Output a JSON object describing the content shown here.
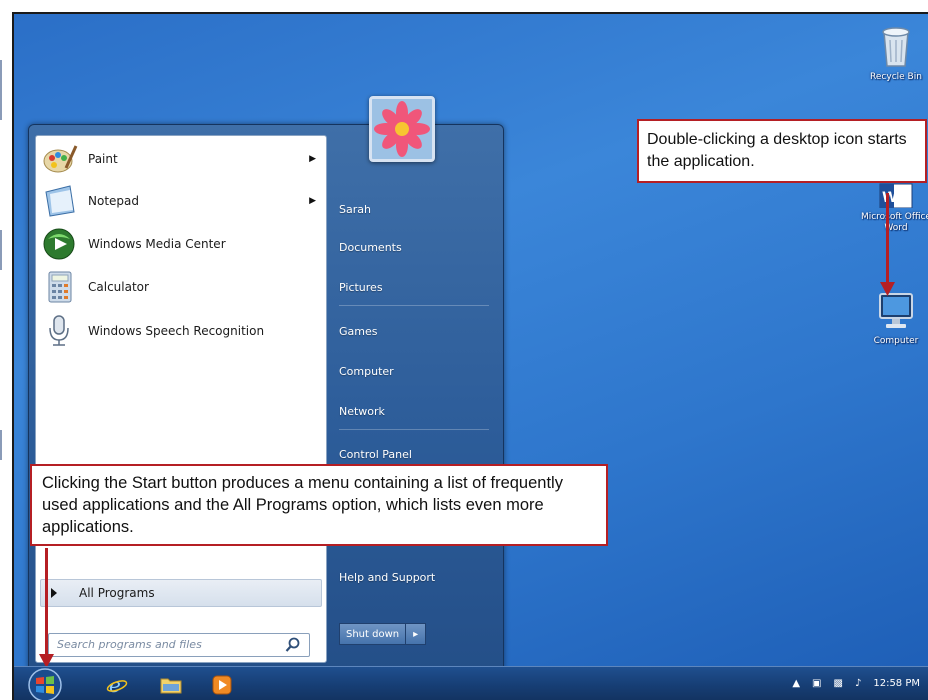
{
  "desktop": {
    "icons": [
      {
        "label": "Recycle Bin",
        "icon": "recycle-bin-icon"
      },
      {
        "label": "Microsoft Office Word",
        "icon": "word-icon"
      },
      {
        "label": "Computer",
        "icon": "computer-icon"
      }
    ]
  },
  "start_menu": {
    "pinned": [
      {
        "label": "Paint",
        "icon": "paint-icon",
        "has_submenu": true
      },
      {
        "label": "Notepad",
        "icon": "notepad-icon",
        "has_submenu": true
      },
      {
        "label": "Windows Media Center",
        "icon": "media-center-icon",
        "has_submenu": false
      },
      {
        "label": "Calculator",
        "icon": "calculator-icon",
        "has_submenu": false
      },
      {
        "label": "Windows Speech Recognition",
        "icon": "microphone-icon",
        "has_submenu": false
      }
    ],
    "all_programs": "All Programs",
    "search_placeholder": "Search programs and files",
    "places": [
      "Sarah",
      "Documents",
      "Pictures",
      "Games",
      "Computer",
      "Network",
      "Control Panel",
      "Help and Support"
    ],
    "shutdown_label": "Shut down"
  },
  "callouts": {
    "desktop_icon": "Double-clicking a desktop icon starts the application.",
    "start_button": "Clicking the Start button produces a menu containing a list of frequently used applications and the All Programs option, which lists even more applications."
  },
  "taskbar": {
    "clock": "12:58 PM"
  },
  "colors": {
    "desktop": "#2e76cc",
    "callout_border": "#b51f24",
    "taskbar": "#173f76"
  }
}
